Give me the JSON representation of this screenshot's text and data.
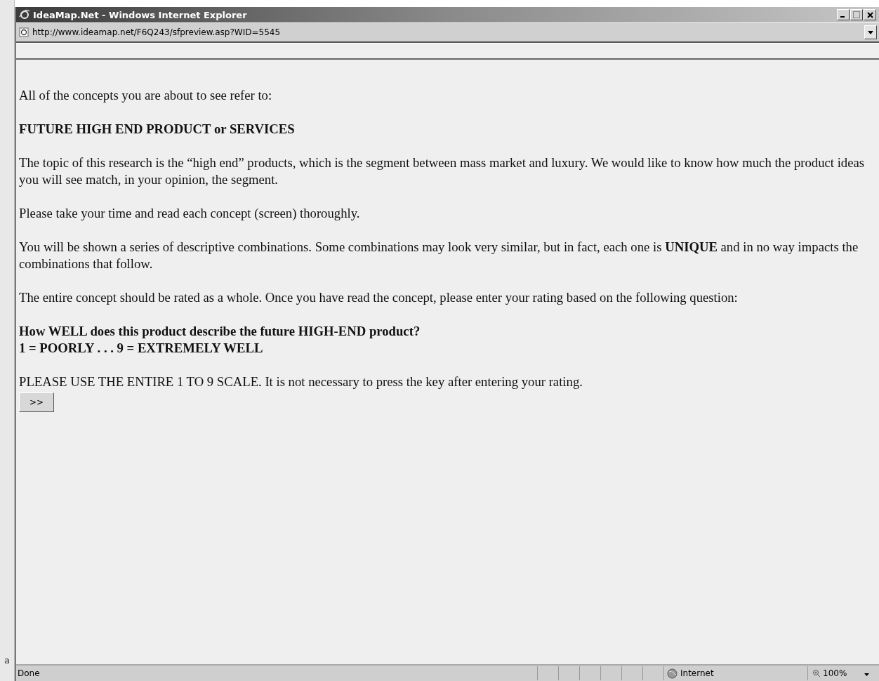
{
  "window": {
    "title": "IdeaMap.Net - Windows Internet Explorer"
  },
  "address_bar": {
    "url": "http://www.ideamap.net/F6Q243/sfpreview.asp?WID=5545"
  },
  "background_fragment": "a",
  "content": {
    "blocks": [
      {
        "kind": "text",
        "text": "All of the concepts you are about to see refer to:"
      },
      {
        "kind": "heading",
        "text": "FUTURE HIGH END PRODUCT or SERVICES"
      },
      {
        "kind": "text",
        "text": "The topic of this research is the “high end” products, which is the segment between mass market and luxury. We would like to know how much the product ideas you will see match, in your opinion, the segment."
      },
      {
        "kind": "text",
        "text": "Please take your time and read each concept (screen) thoroughly."
      },
      {
        "kind": "text",
        "text": "You will be shown a series of descriptive combinations. Some combinations may look very similar, but in fact, each one is **UNIQUE** and in no way impacts the combinations that follow."
      },
      {
        "kind": "text",
        "text": "The entire concept should be rated as a whole. Once you have read the concept, please enter your rating based on the following question:"
      },
      {
        "kind": "heading",
        "lines": [
          "How WELL does this product describe the future HIGH-END product?",
          "1 = POORLY . . . 9 = EXTREMELY WELL"
        ]
      },
      {
        "kind": "tight",
        "text": "PLEASE USE THE ENTIRE 1 TO 9 SCALE. It is not necessary to press the key after entering your rating."
      }
    ],
    "next_button": ">>"
  },
  "status_bar": {
    "text": "Done",
    "zone": "Internet",
    "zoom": "100%"
  }
}
